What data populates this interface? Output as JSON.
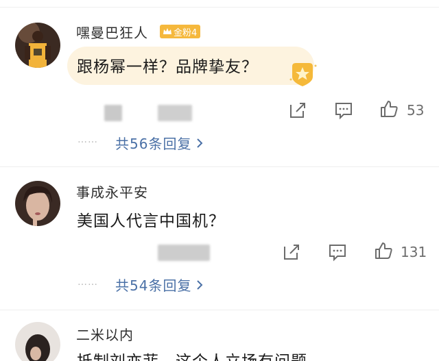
{
  "comments": [
    {
      "username": "嘿曼巴狂人",
      "badge": {
        "text": "金粉4",
        "color": "#f5b83c",
        "icon": "crown-icon"
      },
      "text": "跟杨幂一样？品牌挚友？",
      "highlight_bg": "#fdf3df",
      "star_badge_icon": "star-badge-icon",
      "likes": "53",
      "replies": "共56条回复"
    },
    {
      "username": "事成永平安",
      "text": "美国人代言中国机？",
      "likes": "131",
      "replies": "共54条回复"
    },
    {
      "username": "二米以内",
      "text": "抵制刘亦菲，这个人立场有问题"
    }
  ],
  "reply_prefix": "……",
  "icons": [
    "share-icon",
    "comment-icon",
    "like-icon",
    "chevron-right-icon"
  ],
  "colors": {
    "link": "#4a70a6",
    "count": "#6d6d6d",
    "name": "#2f2f2f",
    "text": "#1a1a1a",
    "divider": "#eeeeee"
  }
}
